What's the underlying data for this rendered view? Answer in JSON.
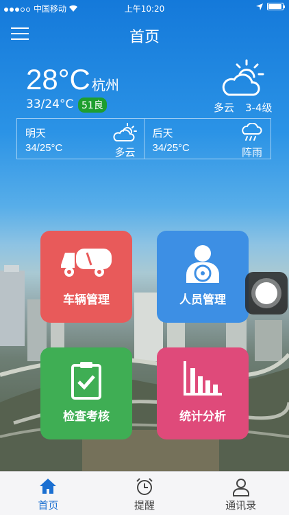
{
  "status_bar": {
    "carrier": "中国移动",
    "time": "上午10:20",
    "signal_bars": 3,
    "battery_level": 0.95
  },
  "nav": {
    "title": "首页",
    "menu_icon": "hamburger-menu-icon"
  },
  "weather": {
    "temperature": "28°C",
    "city": "杭州",
    "range": "33/24°C",
    "aqi": "51良",
    "condition": "多云",
    "wind": "3-4级",
    "icon": "partly-cloudy-icon",
    "forecast": [
      {
        "day": "明天",
        "temp": "34/25°C",
        "condition": "多云",
        "icon": "partly-cloudy-icon"
      },
      {
        "day": "后天",
        "temp": "34/25°C",
        "condition": "阵雨",
        "icon": "shower-icon"
      }
    ]
  },
  "tiles": [
    {
      "label": "车辆管理",
      "icon": "garbage-truck-icon",
      "color": "#e85a5a"
    },
    {
      "label": "人员管理",
      "icon": "driver-icon",
      "color": "#3d8fe4"
    },
    {
      "label": "检查考核",
      "icon": "checklist-icon",
      "color": "#3fae54"
    },
    {
      "label": "统计分析",
      "icon": "bar-chart-icon",
      "color": "#df4a7a"
    }
  ],
  "tabbar": {
    "active_color": "#1a6fd1",
    "items": [
      {
        "label": "首页",
        "icon": "home-icon",
        "active": true
      },
      {
        "label": "提醒",
        "icon": "alarm-clock-icon",
        "active": false
      },
      {
        "label": "通讯录",
        "icon": "contact-person-icon",
        "active": false
      }
    ]
  }
}
